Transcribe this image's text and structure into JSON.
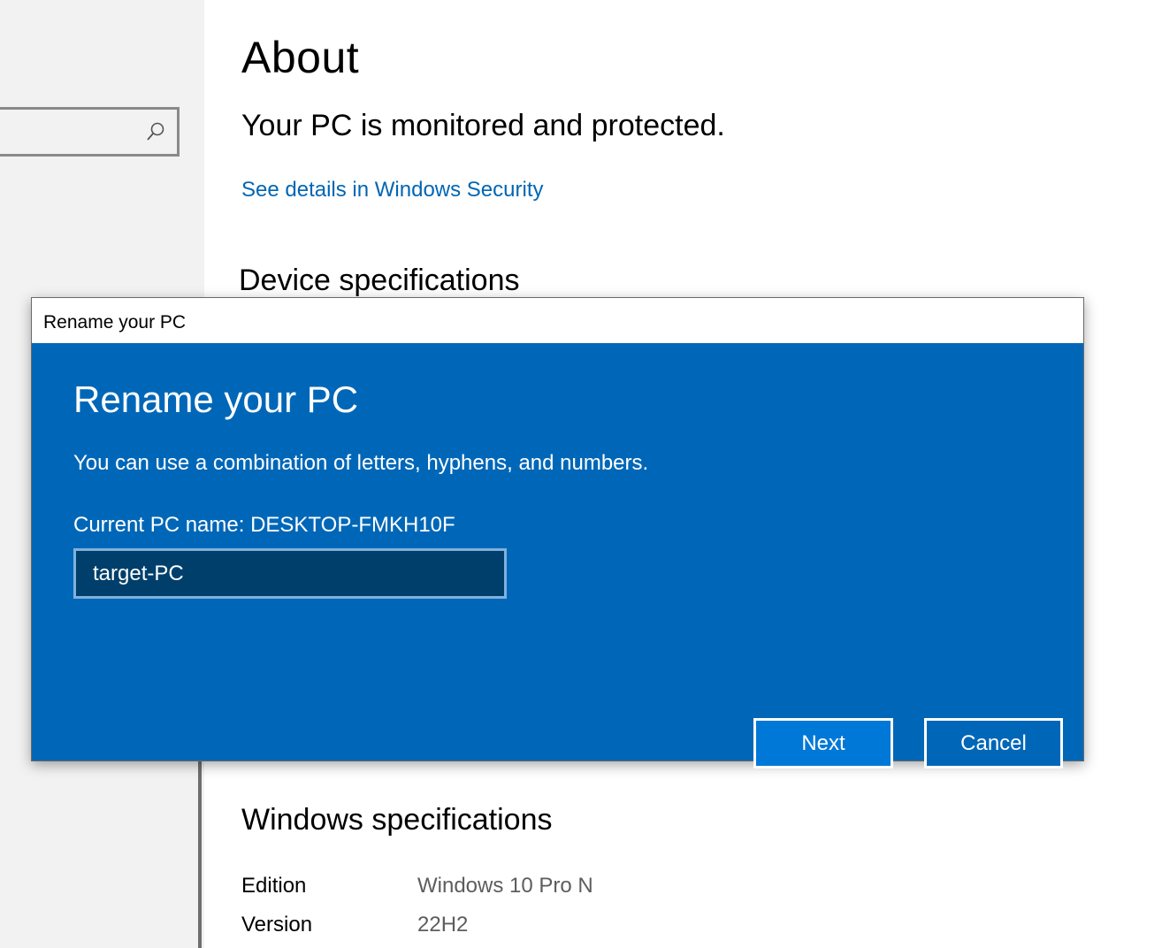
{
  "sidebar": {
    "search": {
      "value": "",
      "icon": "search-icon"
    }
  },
  "main": {
    "title": "About",
    "protection_status": "Your PC is monitored and protected.",
    "security_link": "See details in Windows Security",
    "device_specs_title": "Device specifications",
    "windows_specs_title": "Windows specifications",
    "windows_specs": [
      {
        "label": "Edition",
        "value": "Windows 10 Pro N"
      },
      {
        "label": "Version",
        "value": "22H2"
      }
    ]
  },
  "dialog": {
    "window_title": "Rename your PC",
    "heading": "Rename your PC",
    "description": "You can use a combination of letters, hyphens, and numbers.",
    "current_name_label": "Current PC name:",
    "current_name_value": "DESKTOP-FMKH10F",
    "new_name_value": "target-PC",
    "next_label": "Next",
    "cancel_label": "Cancel"
  },
  "colors": {
    "dialog_background": "#0067b8",
    "accent_button": "#0078d7",
    "input_background": "#003f6b",
    "link": "#0066b4",
    "sidebar": "#f2f2f2"
  }
}
